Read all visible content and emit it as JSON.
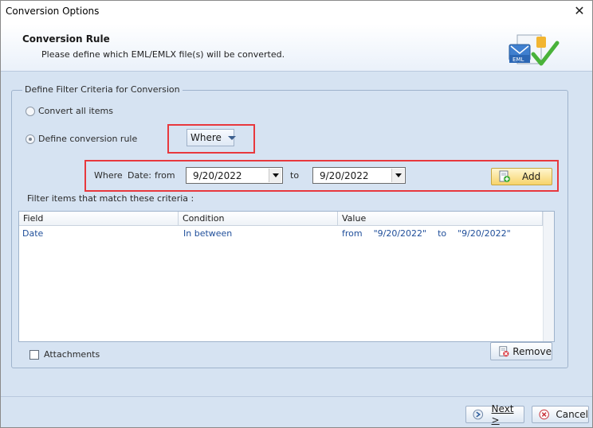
{
  "window": {
    "title": "Conversion Options"
  },
  "header": {
    "title": "Conversion Rule",
    "subtitle": "Please define which EML/EMLX file(s) will be converted.",
    "logo_text": "EML"
  },
  "filter_group": {
    "legend": "Define Filter Criteria for Conversion",
    "options": [
      {
        "label": "Convert all items",
        "selected": false
      },
      {
        "label": "Define conversion rule",
        "selected": true
      }
    ],
    "rule_type": "Where",
    "criteria": {
      "where_label": "Where",
      "field_label": "Date:",
      "from_label": "from",
      "from_value": "9/20/2022",
      "to_label": "to",
      "to_value": "9/20/2022",
      "add_label": "Add"
    },
    "list_caption": "Filter items that match these criteria :",
    "table": {
      "columns": [
        "Field",
        "Condition",
        "Value"
      ],
      "rows": [
        {
          "field": "Date",
          "condition": "In between",
          "value": "from    \"9/20/2022\"    to    \"9/20/2022\""
        }
      ]
    },
    "attachments_label": "Attachments",
    "attachments_checked": false,
    "remove_label": "Remove"
  },
  "footer": {
    "next_label": "Next >",
    "cancel_label": "Cancel"
  },
  "colors": {
    "highlight": "#e8383d",
    "accent": "#1f4e9a",
    "dialog_bg": "#d6e3f2"
  }
}
